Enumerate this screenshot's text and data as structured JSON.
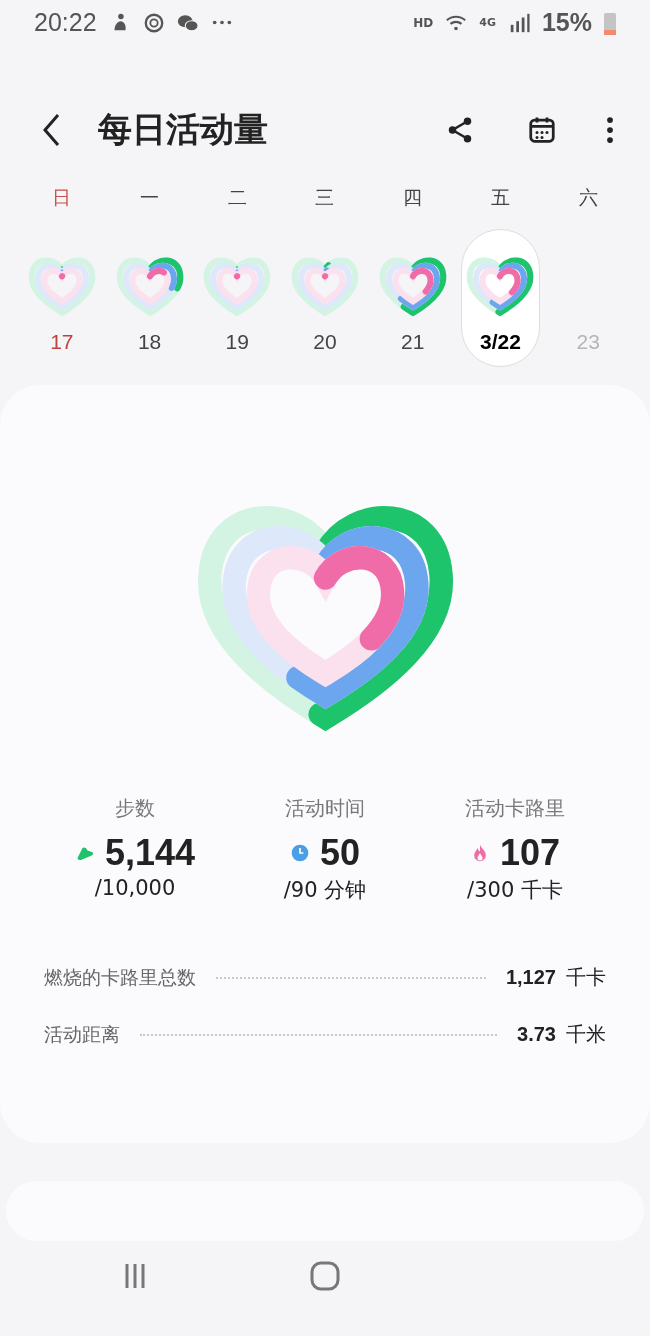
{
  "status_bar": {
    "time": "20:22",
    "hd": "HD",
    "network": "4G",
    "battery": "15%"
  },
  "header": {
    "title": "每日活动量"
  },
  "week": [
    {
      "weekday": "日",
      "date": "17",
      "kind": "sunday",
      "selected": false
    },
    {
      "weekday": "一",
      "date": "18",
      "kind": "past",
      "selected": false
    },
    {
      "weekday": "二",
      "date": "19",
      "kind": "past",
      "selected": false
    },
    {
      "weekday": "三",
      "date": "20",
      "kind": "past",
      "selected": false
    },
    {
      "weekday": "四",
      "date": "21",
      "kind": "past",
      "selected": false
    },
    {
      "weekday": "五",
      "date": "3/22",
      "kind": "past",
      "selected": true
    },
    {
      "weekday": "六",
      "date": "23",
      "kind": "future",
      "selected": false
    }
  ],
  "stats": [
    {
      "kind": "steps",
      "label": "步数",
      "value": "5,144",
      "goal": "/10,000"
    },
    {
      "kind": "time",
      "label": "活动时间",
      "value": "50",
      "goal": "/90 分钟"
    },
    {
      "kind": "calories",
      "label": "活动卡路里",
      "value": "107",
      "goal": "/300 千卡"
    }
  ],
  "details": [
    {
      "label": "燃烧的卡路里总数",
      "value": "1,127",
      "unit": "千卡"
    },
    {
      "label": "活动距离",
      "value": "3.73",
      "unit": "千米"
    }
  ]
}
